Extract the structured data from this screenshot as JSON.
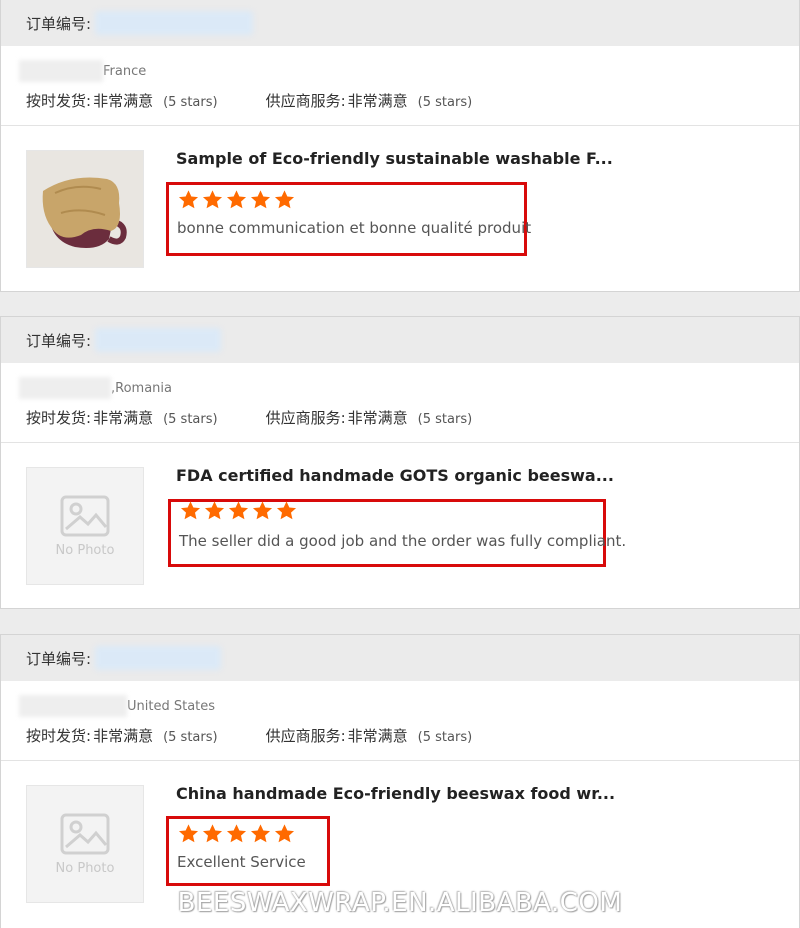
{
  "labels": {
    "order_no": "订单编号:",
    "on_time": "按时发货:",
    "supplier_service": "供应商服务:",
    "rating_value": "非常满意",
    "rating_stars": "(5 stars)",
    "no_photo": "No Photo"
  },
  "colors": {
    "star": "#ff6a00",
    "highlight": "#d80a0a",
    "header": "#ebebeb"
  },
  "orders": [
    {
      "country": "France",
      "product_title": "Sample of Eco-friendly sustainable washable F...",
      "rating": 5,
      "comment": "bonne communication et bonne qualité produit",
      "thumbnail": "product-photo"
    },
    {
      "country": ",Romania",
      "product_title": "FDA certified handmade GOTS organic beeswa...",
      "rating": 5,
      "comment": "The seller did a good job and the order was fully compliant.",
      "thumbnail": "no-photo"
    },
    {
      "country": "United States",
      "product_title": "China handmade Eco-friendly beeswax food wr...",
      "rating": 5,
      "comment": "Excellent Service",
      "thumbnail": "no-photo"
    }
  ],
  "watermark": "BEESWAXWRAP.EN.ALIBABA.COM"
}
